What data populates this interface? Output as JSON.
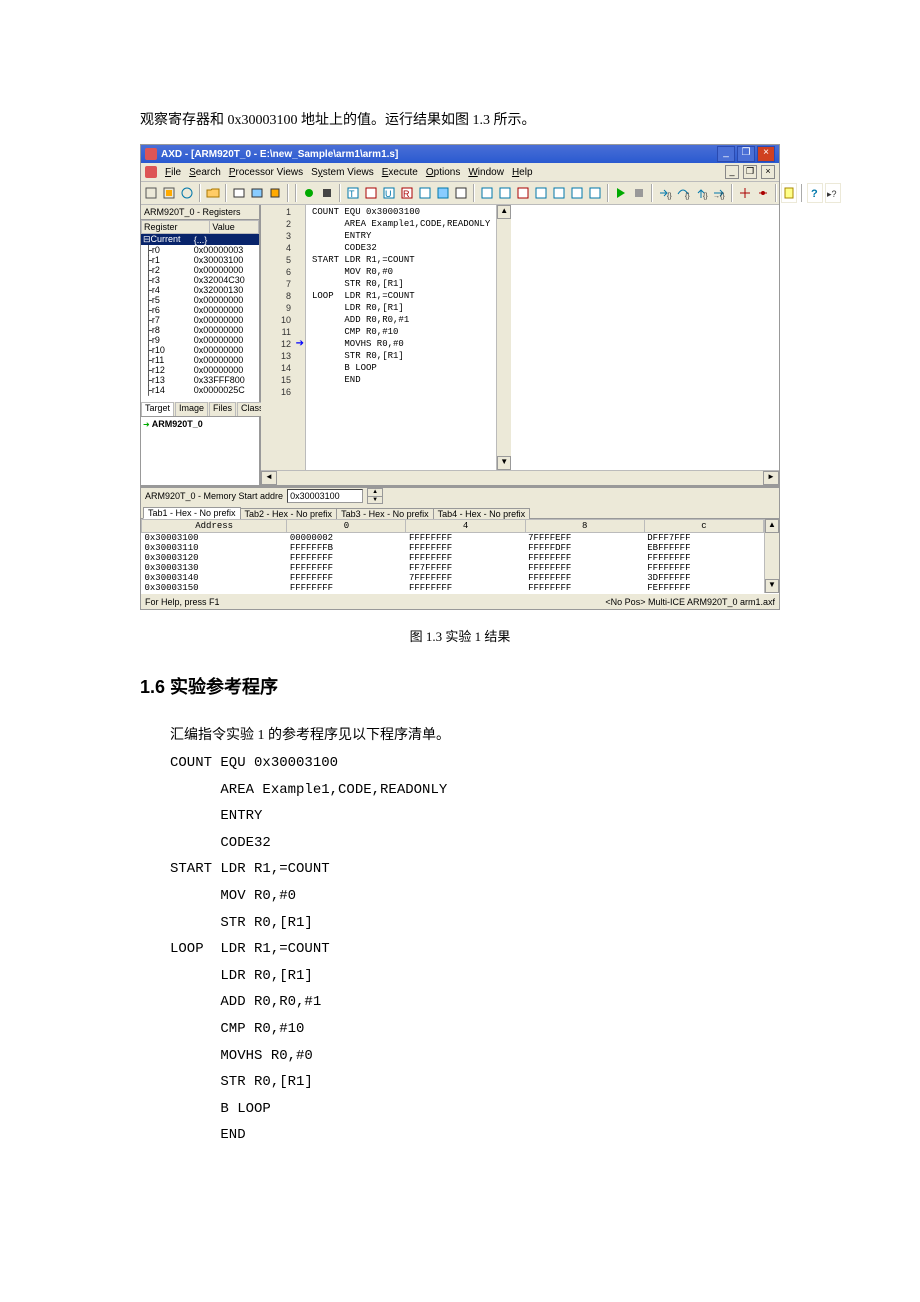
{
  "intro": "观察寄存器和 0x30003100 地址上的值。运行结果如图 1.3 所示。",
  "caption": "图 1.3  实验 1 结果",
  "section_title": "1.6  实验参考程序",
  "body_text": "汇编指令实验 1 的参考程序见以下程序清单。",
  "app": {
    "title": "AXD - [ARM920T_0 - E:\\new_Sample\\arm1\\arm1.s]",
    "menus": [
      "File",
      "Search",
      "Processor Views",
      "System Views",
      "Execute",
      "Options",
      "Window",
      "Help"
    ],
    "regpane_title": "ARM920T_0 - Registers",
    "reg_headers": [
      "Register",
      "Value"
    ],
    "reg_current_label": "Current",
    "reg_current_value": "{...}",
    "registers": [
      {
        "name": "r0",
        "value": "0x00000003"
      },
      {
        "name": "r1",
        "value": "0x30003100"
      },
      {
        "name": "r2",
        "value": "0x00000000"
      },
      {
        "name": "r3",
        "value": "0x32004C30"
      },
      {
        "name": "r4",
        "value": "0x32000130"
      },
      {
        "name": "r5",
        "value": "0x00000000"
      },
      {
        "name": "r6",
        "value": "0x00000000"
      },
      {
        "name": "r7",
        "value": "0x00000000"
      },
      {
        "name": "r8",
        "value": "0x00000000"
      },
      {
        "name": "r9",
        "value": "0x00000000"
      },
      {
        "name": "r10",
        "value": "0x00000000"
      },
      {
        "name": "r11",
        "value": "0x00000000"
      },
      {
        "name": "r12",
        "value": "0x00000000"
      },
      {
        "name": "r13",
        "value": "0x33FFF800"
      },
      {
        "name": "r14",
        "value": "0x0000025C"
      }
    ],
    "tabs": [
      "Target",
      "Image",
      "Files",
      "Class"
    ],
    "tree_node": "ARM920T_0",
    "code_lines": [
      "COUNT EQU 0x30003100",
      "      AREA Example1,CODE,READONLY",
      "      ENTRY",
      "      CODE32",
      "START LDR R1,=COUNT",
      "      MOV R0,#0",
      "      STR R0,[R1]",
      "LOOP  LDR R1,=COUNT",
      "      LDR R0,[R1]",
      "      ADD R0,R0,#1",
      "      CMP R0,#10",
      "      MOVHS R0,#0",
      "      STR R0,[R1]",
      "      B LOOP",
      "      END",
      ""
    ],
    "current_line": 12,
    "mem_title": "ARM920T_0 - Memory  Start addre",
    "mem_addr": "0x30003100",
    "mem_tabs": [
      "Tab1 - Hex - No prefix",
      "Tab2 - Hex - No prefix",
      "Tab3 - Hex - No prefix",
      "Tab4 - Hex - No prefix"
    ],
    "mem_headers": [
      "Address",
      "0",
      "4",
      "8",
      "c"
    ],
    "mem_rows": [
      {
        "addr": "0x30003100",
        "c": [
          "00000002",
          "FFFFFFFF",
          "7FFFFEFF",
          "DFFF7FFF"
        ]
      },
      {
        "addr": "0x30003110",
        "c": [
          "FFFFFFFB",
          "FFFFFFFF",
          "FFFFFDFF",
          "EBFFFFFF"
        ]
      },
      {
        "addr": "0x30003120",
        "c": [
          "FFFFFFFF",
          "FFFFFFFF",
          "FFFFFFFF",
          "FFFFFFFF"
        ]
      },
      {
        "addr": "0x30003130",
        "c": [
          "FFFFFFFF",
          "FF7FFFFF",
          "FFFFFFFF",
          "FFFFFFFF"
        ]
      },
      {
        "addr": "0x30003140",
        "c": [
          "FFFFFFFF",
          "7FFFFFFF",
          "FFFFFFFF",
          "3DFFFFFF"
        ]
      },
      {
        "addr": "0x30003150",
        "c": [
          "FFFFFFFF",
          "FFFFFFFF",
          "FFFFFFFF",
          "FEFFFFFF"
        ]
      }
    ],
    "status_left": "For Help, press F1",
    "status_right": "<No Pos> Multi-ICE ARM920T_0 arm1.axf"
  },
  "program": "COUNT EQU 0x30003100\n      AREA Example1,CODE,READONLY\n      ENTRY\n      CODE32\nSTART LDR R1,=COUNT\n      MOV R0,#0\n      STR R0,[R1]\nLOOP  LDR R1,=COUNT\n      LDR R0,[R1]\n      ADD R0,R0,#1\n      CMP R0,#10\n      MOVHS R0,#0\n      STR R0,[R1]\n      B LOOP\n      END"
}
